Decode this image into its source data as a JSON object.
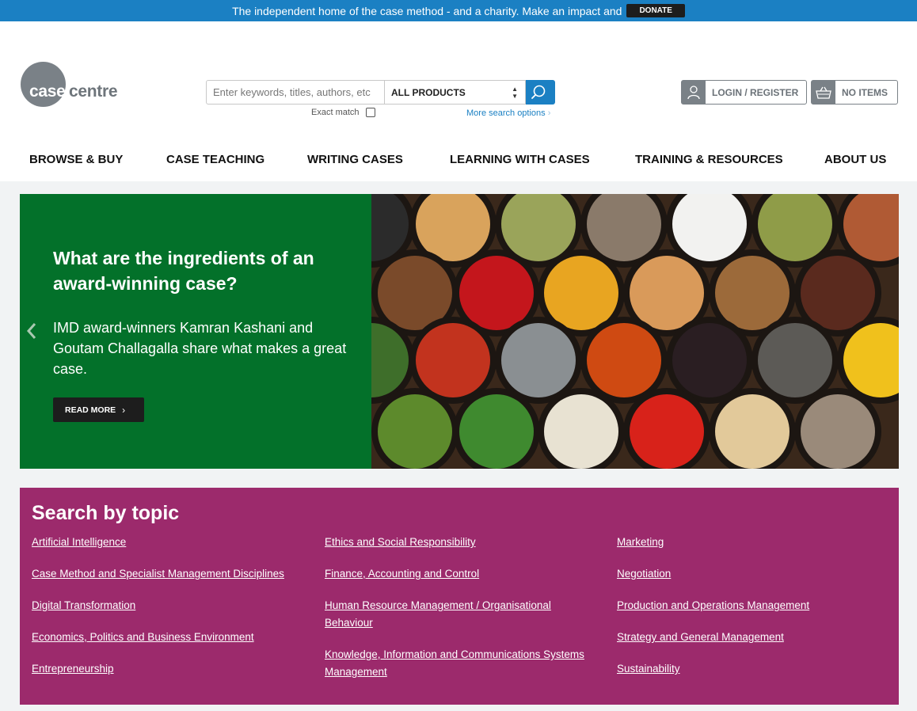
{
  "topbar": {
    "message": "The independent home of the case method - and a charity. Make an impact and",
    "donate_label": "DONATE"
  },
  "logo": {
    "word1": "case",
    "word2": "centre"
  },
  "search": {
    "placeholder": "Enter keywords, titles, authors, etc",
    "product_filter": "ALL PRODUCTS",
    "exact_match_label": "Exact match",
    "more_options_label": "More search options"
  },
  "account": {
    "login_label": "LOGIN / REGISTER",
    "cart_label": "NO ITEMS"
  },
  "nav": {
    "items": [
      {
        "label": "BROWSE & BUY"
      },
      {
        "label": "CASE TEACHING"
      },
      {
        "label": "WRITING CASES"
      },
      {
        "label": "LEARNING WITH CASES"
      },
      {
        "label": "TRAINING & RESOURCES"
      },
      {
        "label": "ABOUT US"
      }
    ]
  },
  "hero": {
    "title": "What are the ingredients of an award-winning case?",
    "subtitle": "IMD award-winners Kamran Kashani and Goutam Challagalla share what makes a great case.",
    "cta_label": "READ MORE"
  },
  "topics": {
    "title": "Search by topic",
    "columns": [
      [
        "Artificial Intelligence",
        "Case Method and Specialist Management Disciplines",
        "Digital Transformation",
        "Economics, Politics and Business Environment",
        "Entrepreneurship"
      ],
      [
        "Ethics and Social Responsibility",
        "Finance, Accounting and Control",
        "Human Resource Management / Organisational Behaviour",
        "Knowledge, Information and Communications Systems Management"
      ],
      [
        "Marketing",
        "Negotiation",
        "Production and Operations Management",
        "Strategy and General Management",
        "Sustainability"
      ]
    ]
  },
  "colors": {
    "topbar": "#1b80c3",
    "hero_bg": "#03712a",
    "topics_bg": "#9c2a6c",
    "logo_gray": "#7a8187"
  }
}
